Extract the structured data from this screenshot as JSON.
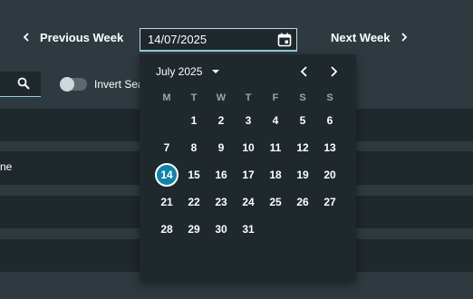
{
  "nav": {
    "prev_label": "Previous Week",
    "next_label": "Next Week"
  },
  "date_input": {
    "value": "14/07/2025"
  },
  "search": {
    "icon": "search-icon"
  },
  "invert": {
    "label": "Invert Sea",
    "checked": false
  },
  "table": {
    "cell_text": "ne"
  },
  "calendar": {
    "month_label": "July 2025",
    "weekdays": [
      "M",
      "T",
      "W",
      "T",
      "F",
      "S",
      "S"
    ],
    "weeks": [
      [
        "",
        "1",
        "2",
        "3",
        "4",
        "5",
        "6"
      ],
      [
        "7",
        "8",
        "9",
        "10",
        "11",
        "12",
        "13"
      ],
      [
        "14",
        "15",
        "16",
        "17",
        "18",
        "19",
        "20"
      ],
      [
        "21",
        "22",
        "23",
        "24",
        "25",
        "26",
        "27"
      ],
      [
        "28",
        "29",
        "30",
        "31",
        "",
        "",
        ""
      ]
    ],
    "selected": "14"
  },
  "colors": {
    "background": "#2e3a40",
    "panel": "#1f282c",
    "accent": "#1283a8",
    "input_underline": "#8fd0e8"
  }
}
